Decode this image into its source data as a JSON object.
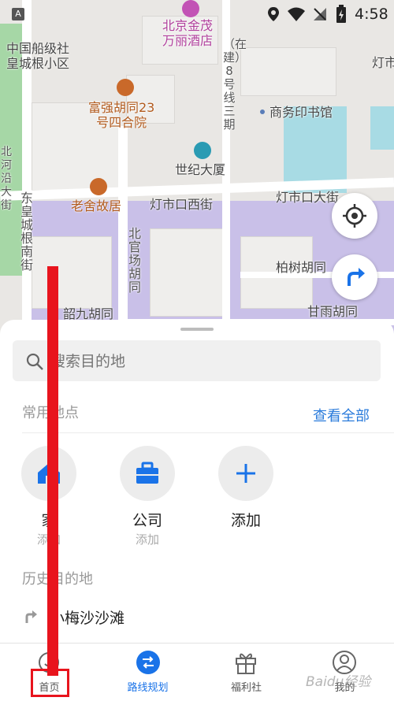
{
  "status_bar": {
    "time": "4:58"
  },
  "map": {
    "pois": {
      "hotel": "北京金茂\n万丽酒店",
      "fuqiang": "富强胡同23\n号四合院",
      "laoshe": "老舍故居",
      "shiji": "世纪大厦"
    },
    "labels": {
      "zhongguo": "中国船级社\n皇城根小区",
      "shangwu": "商务印书馆",
      "dengshi_xi": "灯市口西街",
      "dengshi_da": "灯市口大街",
      "baishu": "柏树胡同",
      "ganyu": "甘雨胡同",
      "shaojiu": "韶九胡同",
      "deng_edge": "灯市",
      "zaijian": "（在建）8号线三期",
      "donghuang": "东皇城根南街",
      "beiguan": "北官场胡同",
      "beihe": "北河沿大街"
    }
  },
  "sheet": {
    "search_placeholder": "搜索目的地",
    "common_places_title": "常用地点",
    "view_all": "查看全部",
    "places": [
      {
        "name": "家",
        "sub": "添加",
        "icon": "home-icon"
      },
      {
        "name": "公司",
        "sub": "添加",
        "icon": "briefcase-icon"
      },
      {
        "name": "添加",
        "sub": "",
        "icon": "plus-icon"
      }
    ],
    "history_title": "历史目的地",
    "history": [
      {
        "name": "小梅沙沙滩",
        "icon": "arrow-icon"
      }
    ]
  },
  "tabs": [
    {
      "label": "首页",
      "icon": "home-tab-icon",
      "active": false
    },
    {
      "label": "路线规划",
      "icon": "route-icon",
      "active": true
    },
    {
      "label": "福利社",
      "icon": "gift-icon",
      "active": false
    },
    {
      "label": "我的",
      "icon": "user-icon",
      "active": false
    }
  ],
  "watermark": "Baidu经验",
  "colors": {
    "accent": "#1a73e8",
    "annotation": "#e8141d",
    "park": "#c9c0e8",
    "green_strip": "#a6d7a6",
    "water": "#a8dbe4"
  }
}
